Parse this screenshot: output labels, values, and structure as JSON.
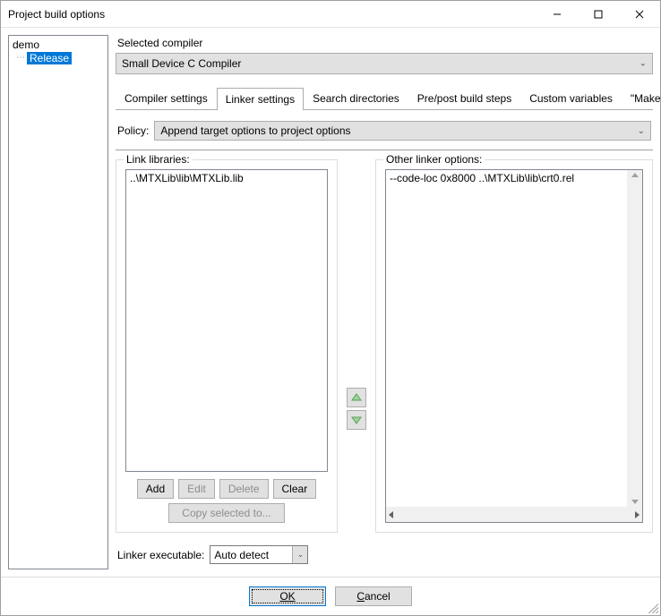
{
  "title": "Project build options",
  "tree": {
    "root": "demo",
    "child": "Release"
  },
  "compiler": {
    "label": "Selected compiler",
    "value": "Small Device C Compiler"
  },
  "tabs": [
    "Compiler settings",
    "Linker settings",
    "Search directories",
    "Pre/post build steps",
    "Custom variables",
    "\"Make\""
  ],
  "active_tab_index": 1,
  "policy": {
    "label": "Policy:",
    "value": "Append target options to project options"
  },
  "link_libraries": {
    "legend": "Link libraries:",
    "items": [
      "..\\MTXLib\\lib\\MTXLib.lib"
    ],
    "buttons": {
      "add": "Add",
      "edit": "Edit",
      "delete": "Delete",
      "clear": "Clear",
      "copy": "Copy selected to..."
    }
  },
  "other_linker": {
    "legend": "Other linker options:",
    "text": "--code-loc 0x8000 ..\\MTXLib\\lib\\crt0.rel"
  },
  "linker_exec": {
    "label": "Linker executable:",
    "value": "Auto detect"
  },
  "bottom": {
    "ok": "OK",
    "cancel": "Cancel"
  }
}
